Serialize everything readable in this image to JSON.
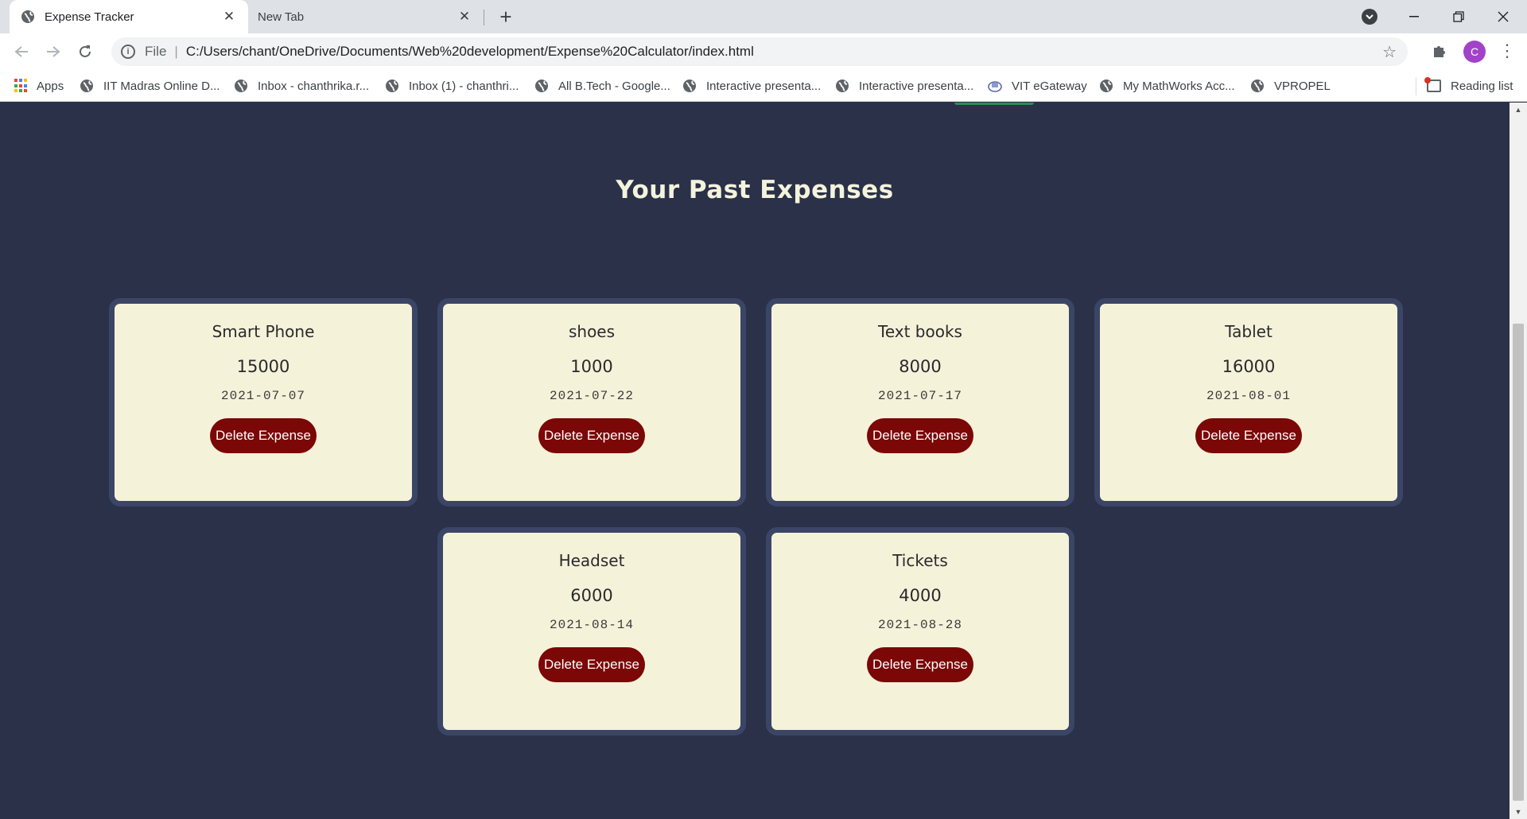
{
  "browser": {
    "tabs": [
      {
        "title": "Expense Tracker",
        "active": true
      },
      {
        "title": "New Tab",
        "active": false
      }
    ],
    "new_tab_symbol": "+",
    "close_symbol": "✕",
    "address": {
      "scheme": "File",
      "url": "C:/Users/chant/OneDrive/Documents/Web%20development/Expense%20Calculator/index.html"
    },
    "profile_initial": "C",
    "bookmarks": [
      {
        "label": "Apps",
        "icon": "apps-grid-icon"
      },
      {
        "label": "IIT Madras Online D...",
        "icon": "globe-icon"
      },
      {
        "label": "Inbox - chanthrika.r...",
        "icon": "globe-icon"
      },
      {
        "label": "Inbox (1) - chanthri...",
        "icon": "globe-icon"
      },
      {
        "label": "All B.Tech - Google...",
        "icon": "globe-icon"
      },
      {
        "label": "Interactive presenta...",
        "icon": "globe-icon"
      },
      {
        "label": "Interactive presenta...",
        "icon": "globe-icon"
      },
      {
        "label": "VIT eGateway",
        "icon": "vit-logo-icon"
      },
      {
        "label": "My MathWorks Acc...",
        "icon": "globe-icon"
      },
      {
        "label": "VPROPEL",
        "icon": "globe-icon"
      }
    ],
    "reading_list": "Reading list"
  },
  "page": {
    "title": "Your Past Expenses",
    "delete_label": "Delete Expense",
    "expenses": [
      {
        "name": "Smart Phone",
        "amount": "15000",
        "date": "2021-07-07"
      },
      {
        "name": "shoes",
        "amount": "1000",
        "date": "2021-07-22"
      },
      {
        "name": "Text books",
        "amount": "8000",
        "date": "2021-07-17"
      },
      {
        "name": "Tablet",
        "amount": "16000",
        "date": "2021-08-01"
      },
      {
        "name": "Headset",
        "amount": "6000",
        "date": "2021-08-14"
      },
      {
        "name": "Tickets",
        "amount": "4000",
        "date": "2021-08-28"
      }
    ]
  },
  "colors": {
    "page_background": "#2a3149",
    "card_background": "#f5f2da",
    "card_border": "#3b4566",
    "delete_button": "#7b0707",
    "title_text": "#f4f3dc"
  }
}
